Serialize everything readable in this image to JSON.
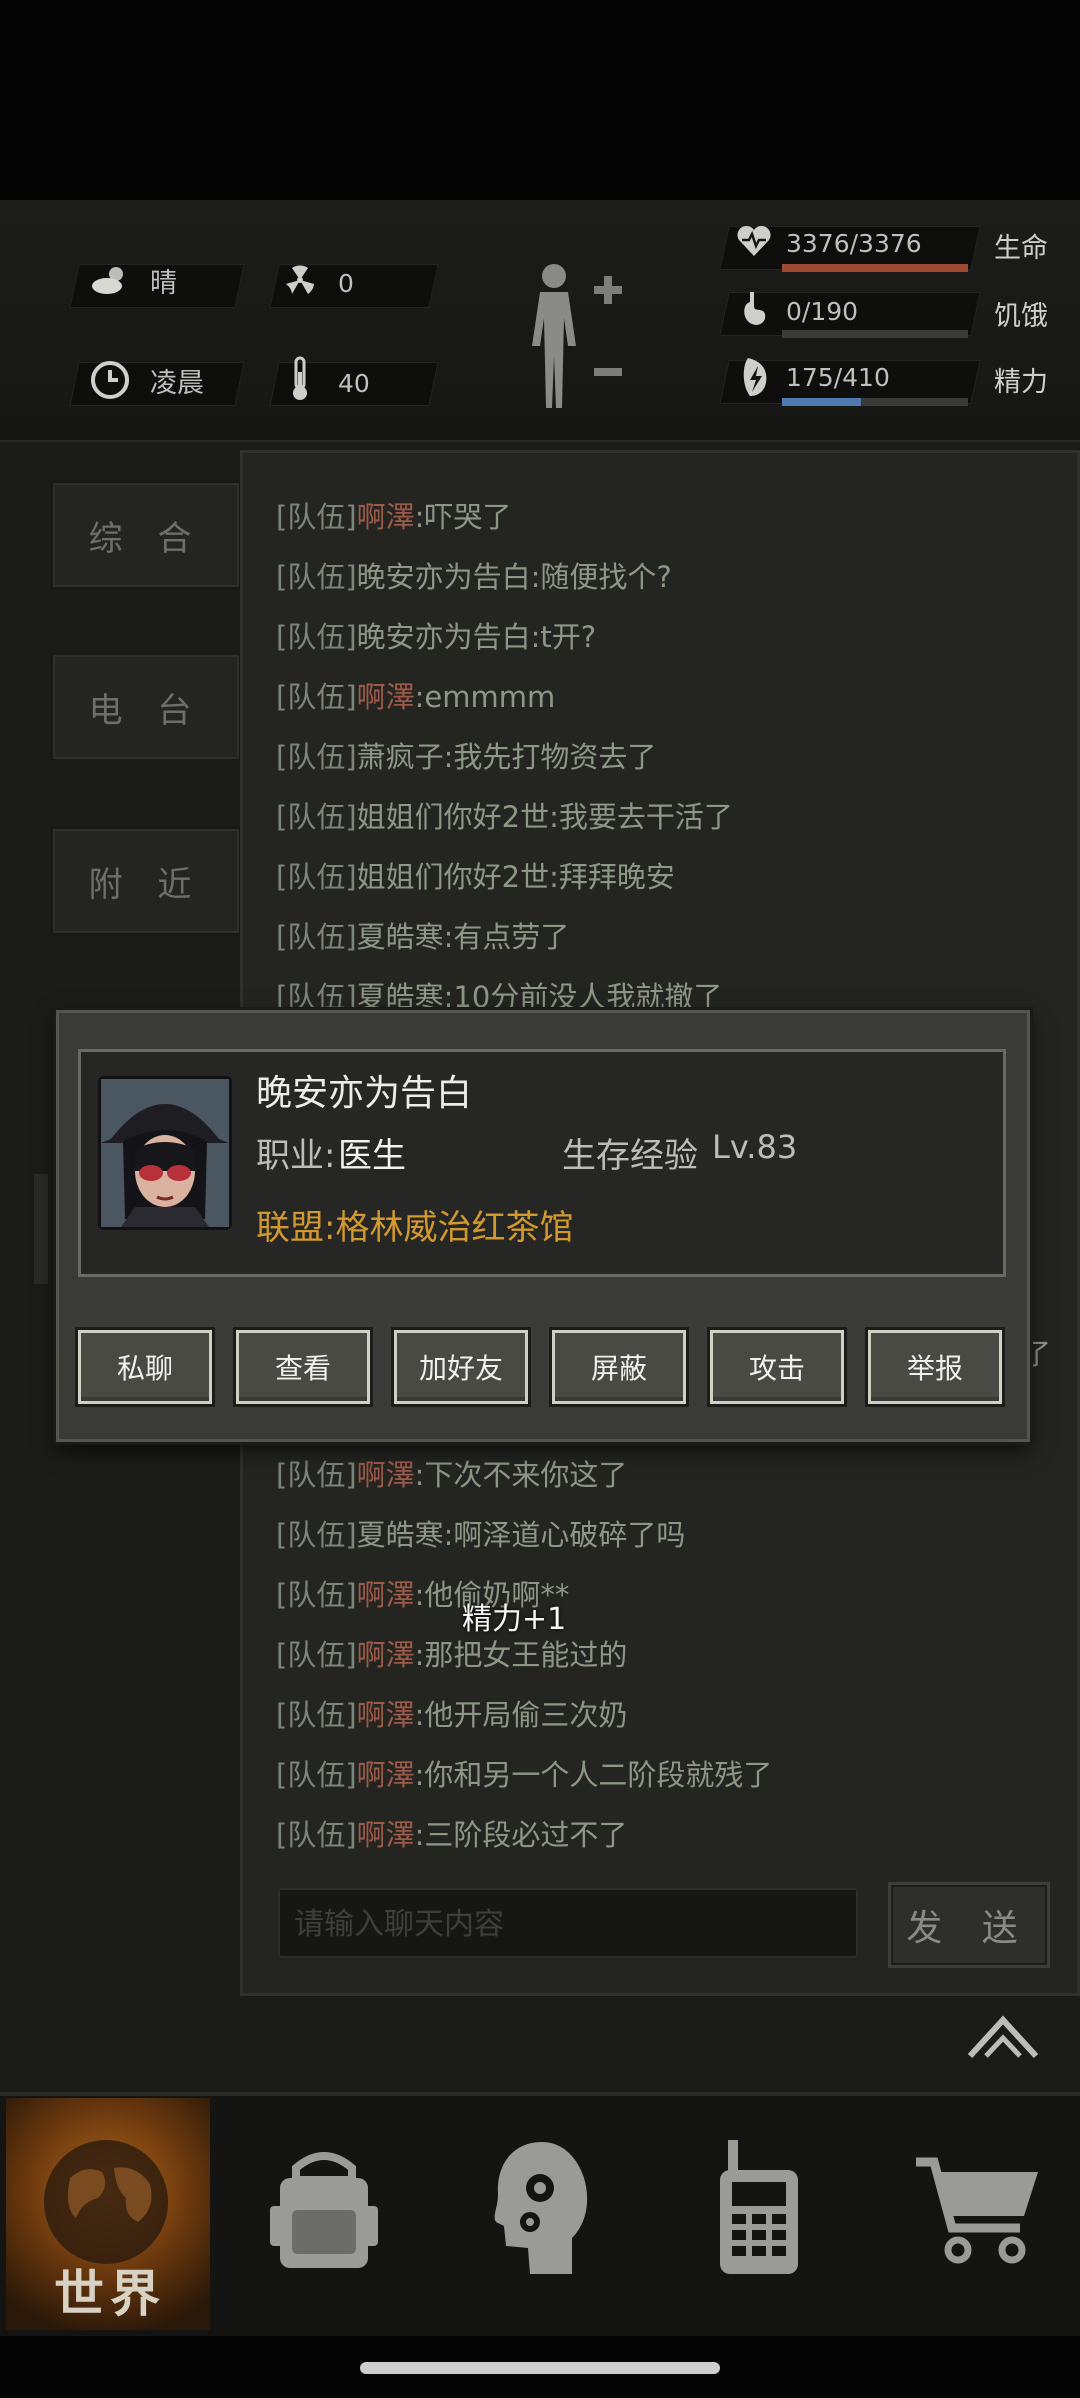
{
  "hud": {
    "weather": "晴",
    "radiation": "0",
    "time_of_day": "凌晨",
    "temperature": "40",
    "hp": {
      "text": "3376/3376",
      "label": "生命",
      "fraction": 1.0,
      "color": "#a04a34"
    },
    "hunger": {
      "text": "0/190",
      "label": "饥饿",
      "fraction": 0.0,
      "color": "#6c6c6a"
    },
    "energy": {
      "text": "175/410",
      "label": "精力",
      "fraction": 0.427,
      "color": "#4f7ab0"
    }
  },
  "tabs": [
    "综 合",
    "电 台",
    "附 近"
  ],
  "chat": {
    "channel": "[队伍]",
    "messages_top": [
      {
        "name": "啊澤",
        "text": ":吓哭了",
        "color": "red"
      },
      {
        "name": "晚安亦为告白",
        "text": ":随便找个?",
        "color": "grn"
      },
      {
        "name": "晚安亦为告白",
        "text": ":t开?",
        "color": "grn"
      },
      {
        "name": "啊澤",
        "text": ":emmmm",
        "color": "red"
      },
      {
        "name": "萧疯子",
        "text": ":我先打物资去了",
        "color": "grn"
      },
      {
        "name": "姐姐们你好2世",
        "text": ":我要去干活了",
        "color": "grn"
      },
      {
        "name": "姐姐们你好2世",
        "text": ":拜拜晚安",
        "color": "grn"
      },
      {
        "name": "夏皓寒",
        "text": ":有点劳了",
        "color": "grn"
      },
      {
        "name": "夏皓寒",
        "text": ":10分前没人我就撤了",
        "color": "grn"
      }
    ],
    "messages_bottom": [
      {
        "name": "啊澤",
        "text": ":下次不来你这了",
        "color": "red"
      },
      {
        "name": "夏皓寒",
        "text": ":啊泽道心破碎了吗",
        "color": "grn"
      },
      {
        "name": "啊澤",
        "text": ":他偷奶啊**",
        "color": "red"
      },
      {
        "name": "啊澤",
        "text": ":那把女王能过的",
        "color": "red"
      },
      {
        "name": "啊澤",
        "text": ":他开局偷三次奶",
        "color": "red"
      },
      {
        "name": "啊澤",
        "text": ":你和另一个人二阶段就残了",
        "color": "red"
      },
      {
        "name": "啊澤",
        "text": ":三阶段必过不了",
        "color": "red"
      }
    ],
    "partial_right": "了",
    "input_placeholder": "请输入聊天内容",
    "send_label": "发 送"
  },
  "popup": {
    "player_name": "晚安亦为告白",
    "job_label": "职业:",
    "job_value": "医生",
    "exp_label": "生存经验",
    "exp_value": "Lv.83",
    "alliance": "联盟:格林威治红茶馆",
    "buttons": [
      "私聊",
      "查看",
      "加好友",
      "屏蔽",
      "攻击",
      "举报"
    ]
  },
  "float_text": "精力+1",
  "nav": {
    "world_label": "世界",
    "items": [
      "backpack-icon",
      "skills-head-icon",
      "radio-phone-icon",
      "shop-cart-icon"
    ]
  }
}
